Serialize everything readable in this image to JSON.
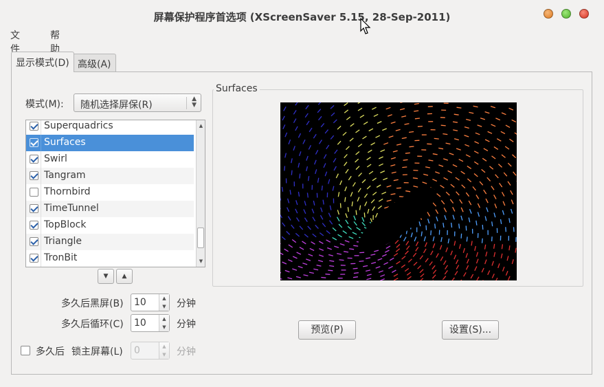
{
  "window": {
    "title": "屏幕保护程序首选项  (XScreenSaver 5.15, 28-Sep-2011)"
  },
  "menubar": {
    "items": [
      "文件(F)",
      "帮助(H)"
    ]
  },
  "tabs": [
    {
      "label": "显示模式(D)",
      "active": true
    },
    {
      "label": "高级(A)",
      "active": false
    }
  ],
  "mode": {
    "label": "模式(M):",
    "selected": "随机选择屏保(R)"
  },
  "screensavers": [
    {
      "name": "Superquadrics",
      "checked": true,
      "selected": false
    },
    {
      "name": "Surfaces",
      "checked": true,
      "selected": true
    },
    {
      "name": "Swirl",
      "checked": true,
      "selected": false
    },
    {
      "name": "Tangram",
      "checked": true,
      "selected": false
    },
    {
      "name": "Thornbird",
      "checked": false,
      "selected": false
    },
    {
      "name": "TimeTunnel",
      "checked": true,
      "selected": false
    },
    {
      "name": "TopBlock",
      "checked": true,
      "selected": false
    },
    {
      "name": "Triangle",
      "checked": true,
      "selected": false
    },
    {
      "name": "TronBit",
      "checked": true,
      "selected": false
    }
  ],
  "settings": {
    "blank_after": {
      "label": "多久后黑屏(B)",
      "value": "10",
      "unit": "分钟"
    },
    "cycle_after": {
      "label": "多久后循环(C)",
      "value": "10",
      "unit": "分钟"
    },
    "lock_after": {
      "prefix": "多久后",
      "label": "锁主屏幕(L)",
      "value": "0",
      "unit": "分钟",
      "checked": false,
      "enabled": false
    }
  },
  "preview": {
    "frame_label": "Surfaces"
  },
  "buttons": {
    "preview": "预览(P)",
    "settings": "设置(S)..."
  },
  "icons": {
    "list_down": "chevron-down-icon",
    "list_up": "chevron-up-icon",
    "cursor": "pointer-cursor-icon"
  },
  "colors": {
    "selection": "#4a90d9",
    "window_bg": "#f2f1f0",
    "close": "#d6301f",
    "minimize": "#e07a1f",
    "maximize": "#4fb22a"
  }
}
